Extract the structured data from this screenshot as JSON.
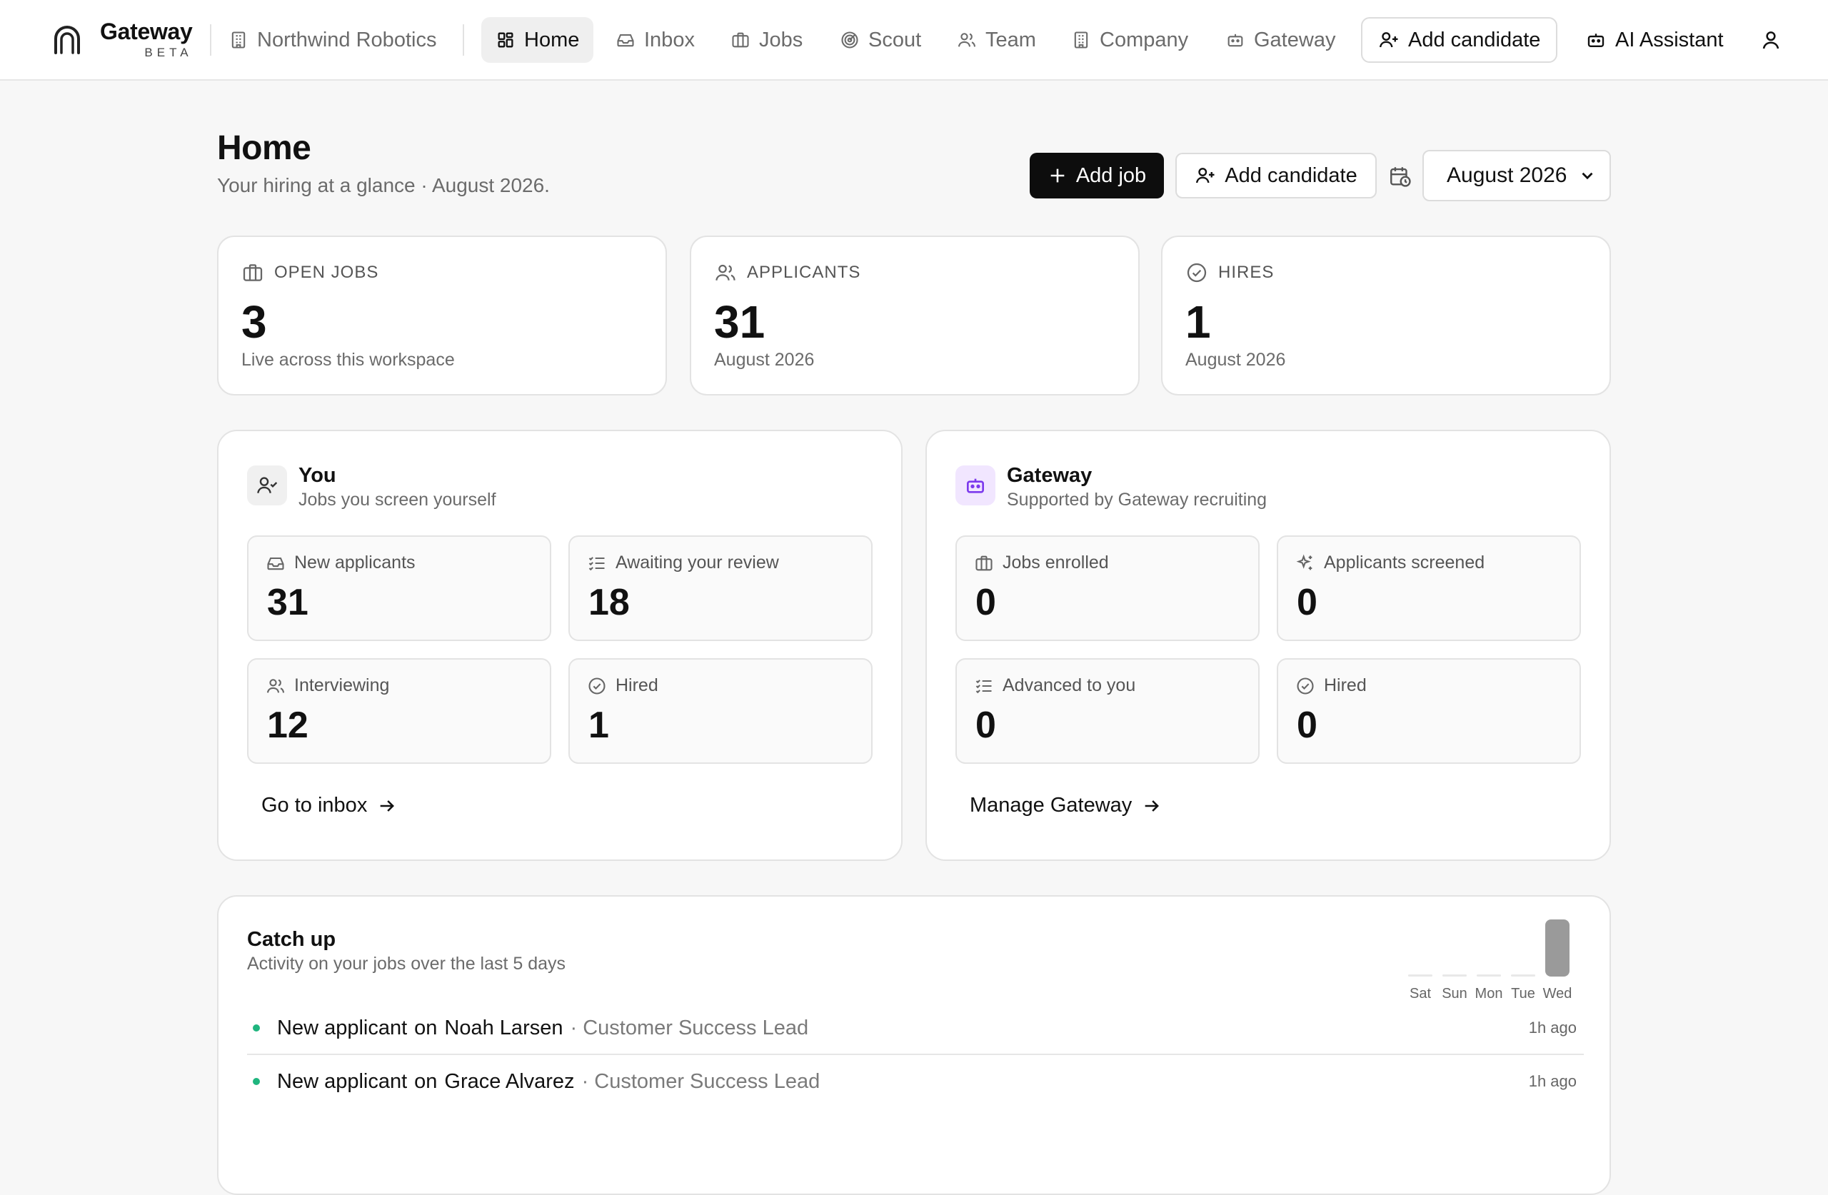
{
  "brand": {
    "name": "Gateway",
    "badge": "BETA"
  },
  "nav": {
    "workspace": "Northwind Robotics",
    "items": [
      {
        "label": "Home",
        "icon": "grid-icon",
        "active": true
      },
      {
        "label": "Inbox",
        "icon": "inbox-icon"
      },
      {
        "label": "Jobs",
        "icon": "briefcase-icon"
      },
      {
        "label": "Scout",
        "icon": "target-icon"
      },
      {
        "label": "Team",
        "icon": "users-icon"
      },
      {
        "label": "Company",
        "icon": "building-icon"
      },
      {
        "label": "Gateway",
        "icon": "bot-icon"
      }
    ],
    "add_candidate": "Add candidate",
    "ai_assistant": "AI Assistant"
  },
  "header": {
    "title": "Home",
    "subtitle": "Your hiring at a glance · August 2026.",
    "add_job": "Add job",
    "add_candidate": "Add candidate",
    "month": "August 2026"
  },
  "stats": [
    {
      "label": "OPEN JOBS",
      "value": "3",
      "sub": "Live across this workspace",
      "icon": "briefcase-icon"
    },
    {
      "label": "APPLICANTS",
      "value": "31",
      "sub": "August 2026",
      "icon": "users-icon"
    },
    {
      "label": "HIRES",
      "value": "1",
      "sub": "August 2026",
      "icon": "check-circle-icon"
    }
  ],
  "you": {
    "title": "You",
    "subtitle": "Jobs you screen yourself",
    "metrics": [
      {
        "label": "New applicants",
        "value": "31",
        "icon": "inbox-icon"
      },
      {
        "label": "Awaiting your review",
        "value": "18",
        "icon": "list-check-icon"
      },
      {
        "label": "Interviewing",
        "value": "12",
        "icon": "users-icon"
      },
      {
        "label": "Hired",
        "value": "1",
        "icon": "check-circle-icon"
      }
    ],
    "link": "Go to inbox"
  },
  "gateway": {
    "title": "Gateway",
    "subtitle": "Supported by Gateway recruiting",
    "metrics": [
      {
        "label": "Jobs enrolled",
        "value": "0",
        "icon": "briefcase-icon"
      },
      {
        "label": "Applicants screened",
        "value": "0",
        "icon": "sparkles-icon"
      },
      {
        "label": "Advanced to you",
        "value": "0",
        "icon": "list-check-icon"
      },
      {
        "label": "Hired",
        "value": "0",
        "icon": "check-circle-icon"
      }
    ],
    "link": "Manage Gateway"
  },
  "catchup": {
    "title": "Catch up",
    "subtitle": "Activity on your jobs over the last 5 days",
    "chart_data": {
      "type": "bar",
      "categories": [
        "Sat",
        "Sun",
        "Mon",
        "Tue",
        "Wed"
      ],
      "values": [
        0,
        0,
        0,
        0,
        31
      ],
      "highlight": "Wed"
    },
    "activity": [
      {
        "action": "New applicant",
        "connector": "on",
        "name": "Noah Larsen",
        "role": "· Customer Success Lead",
        "time": "1h ago"
      },
      {
        "action": "New applicant",
        "connector": "on",
        "name": "Grace Alvarez",
        "role": "· Customer Success Lead",
        "time": "1h ago"
      }
    ]
  },
  "colors": {
    "accent": "#0d0d0d",
    "activity_dot": "#1fb57e",
    "gateway_tint": "#f1e6ff",
    "gateway_icon": "#7c3aed"
  }
}
